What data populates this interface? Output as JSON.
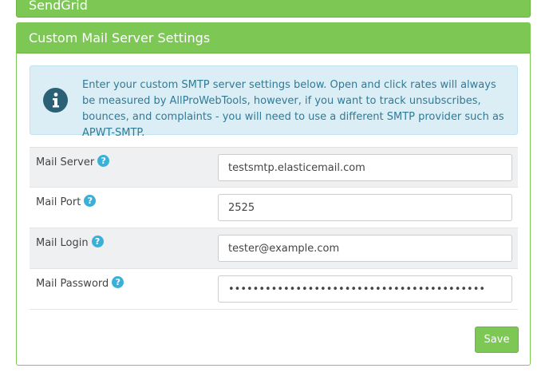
{
  "top_panel": {
    "title": "SendGrid"
  },
  "panel": {
    "title": "Custom Mail Server Settings",
    "alert_text": "Enter your custom SMTP server settings below. Open and click rates will always be measured by AllProWebTools, however, if you want to track unsubscribes, bounces, and complaints - you will need to use a different SMTP provider such as APWT-SMTP."
  },
  "fields": {
    "server": {
      "label": "Mail Server",
      "value": "testsmtp.elasticemail.com"
    },
    "port": {
      "label": "Mail Port",
      "value": "2525"
    },
    "login": {
      "label": "Mail Login",
      "value": "tester@example.com"
    },
    "password": {
      "label": "Mail Password",
      "value": "••••••••••••••••••••••••••••••••••••••••••"
    }
  },
  "help_glyph": "?",
  "info_glyph": "i",
  "buttons": {
    "save_label": "Save"
  },
  "colors": {
    "accent_green": "#7dc855",
    "alert_bg": "#dbeef5",
    "alert_text": "#2f7a97",
    "help_blue": "#3ab0d8",
    "info_dark": "#2b6177"
  }
}
